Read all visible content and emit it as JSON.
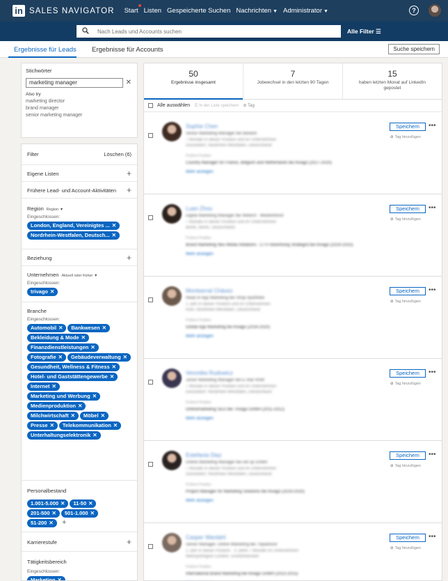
{
  "nav": {
    "logo_in": "in",
    "brand": "SALES NAVIGATOR",
    "links": [
      {
        "label": "Start",
        "dot": true
      },
      {
        "label": "Listen"
      },
      {
        "label": "Gespeicherte Suchen"
      },
      {
        "label": "Nachrichten",
        "caret": true
      },
      {
        "label": "Administrator",
        "caret": true
      }
    ],
    "help_icon": "?"
  },
  "search": {
    "placeholder": "Nach Leads und Accounts suchen",
    "all_filters": "Alle Filter"
  },
  "tabs": {
    "leads": "Ergebnisse für Leads",
    "accounts": "Ergebnisse für Accounts",
    "save_search": "Suche speichern"
  },
  "keywords": {
    "label": "Stichwörter",
    "value": "marketing manager",
    "also_try": "Also try",
    "suggestions": [
      "marketing director",
      "brand manager",
      "senior marketing manager"
    ]
  },
  "filters": {
    "header": "Filter",
    "reset": "Löschen (6)",
    "included_label": "Eingeschlossen:",
    "own_lists": "Eigene Listen",
    "prior_activity": "Frühere Lead- und Account-Aktivitäten",
    "region": {
      "title": "Region",
      "select": "Region",
      "pills": [
        "London, England, Vereinigtes ...",
        "Nordrhein-Westfalen, Deutsch..."
      ]
    },
    "relationship": "Beziehung",
    "company": {
      "title": "Unternehmen",
      "select": "Aktuell oder früher",
      "pills": [
        "trivago"
      ]
    },
    "industry": {
      "title": "Branche",
      "pills": [
        "Automobil",
        "Bankwesen",
        "Bekleidung & Mode",
        "Finanzdienstleistungen",
        "Fotografie",
        "Gebäudeverwaltung",
        "Gesundheit, Wellness & Fitness",
        "Hotel- und Gaststättengewerbe",
        "Internet",
        "Marketing und Werbung",
        "Medienproduktion",
        "Milchwirtschaft",
        "Möbel",
        "Presse",
        "Telekommunikation",
        "Unterhaltungselektronik"
      ]
    },
    "headcount": {
      "title": "Personalbestand",
      "pills": [
        "1.001-5.000",
        "11-50",
        "201-500",
        "501-1.000",
        "51-200"
      ]
    },
    "seniority": "Karrierestufe",
    "function": {
      "title": "Tätigkeitsbereich",
      "pills": [
        "Marketing"
      ]
    }
  },
  "stats": [
    {
      "number": "50",
      "label": "Ergebnisse insgesamt"
    },
    {
      "number": "7",
      "label": "Jobwechsel in den letzten 90 Tagen"
    },
    {
      "number": "15",
      "label": "haben letzten Monat auf LinkedIn gepostet"
    }
  ],
  "bulk": {
    "select_all": "Alle auswählen",
    "add_to_list": "In der Liste speichern",
    "tag": "Tag"
  },
  "lead_actions": {
    "save": "Speichern",
    "more": "•••",
    "add_tag": "Tag hinzufügen"
  },
  "leads": [
    {
      "name": "Sophie Chen",
      "title": "Senior Marketing Manager bei Beeeim",
      "l1": "7 Monate in dieser Position und im Unternehmen",
      "l2": "Düsseldorf, Nordrhein-Westfalen, Deutschland",
      "prev_label": "Frühere Position",
      "prev": "Country Manager for France, Belgium and Netherlands bei trivago  (2017-2020)",
      "more": "Mehr anzeigen",
      "photo": "#3e2a22"
    },
    {
      "name": "Luan Zhou",
      "title": "Digital Marketing Manager bei Wetech · Medientrend",
      "l1": "7 Monate in dieser Position und im Unternehmen",
      "l2": "Berlin, Berlin, Deutschland",
      "prev_label": "Frühere Position",
      "prev": "Brand Marketing Neu Media Relations - CTV Advertising Strategist bei trivago  (2019-2020)",
      "more": "Mehr anzeigen",
      "photo": "#2b211c"
    },
    {
      "name": "Montserrat Chávez",
      "title": "Head of App Marketing bei Shop Apotheke",
      "l1": "1 Jahr in dieser Position und im Unternehmen",
      "l2": "Köln, Nordrhein-Westfalen, Deutschland",
      "prev_label": "Frühere Position",
      "prev": "Global App Marketing bei trivago  (2016-2020)",
      "more": "Mehr anzeigen",
      "photo": "#6b5a4c"
    },
    {
      "name": "Veronika Rudowicz",
      "title": "Junior Marketing Manager bei E-Star RAM",
      "l1": "7 Monate in dieser Position und im Unternehmen",
      "l2": "Düsseldorf, Nordrhein-Westfalen, Deutschland",
      "prev_label": "Frühere Position",
      "prev": "Onlinemarketing SEO bei Trivago GmbH  (2011-2012)",
      "more": "Mehr anzeigen",
      "photo": "#3a3550"
    },
    {
      "name": "Estefania Diaz",
      "title": "Online Marketing Manager bei set up GmbH",
      "l1": "7 Monate in dieser Position und im Unternehmen",
      "l2": "Düsseldorf, Nordrhein-Westfalen, Deutschland",
      "prev_label": "Frühere Position",
      "prev": "Project Manager for Marketing Solutions bei trivago  (2019-2020)",
      "more": "Mehr anzeigen",
      "photo": "#2a2220"
    },
    {
      "name": "Casper Wardahl",
      "title": "Senior Manager, Online Marketing bei Tripadvisor",
      "l1": "1 Jahr in dieser Position · 3 Jahre 7 Monate im Unternehmen",
      "l2": "Metropolregion London, Großbritannien",
      "prev_label": "Frühere Position",
      "prev": "International Brand Marketing bei trivago GmbH  (2013-2015)",
      "more": "Mehr anzeigen",
      "photo": "#7a6a60"
    }
  ]
}
